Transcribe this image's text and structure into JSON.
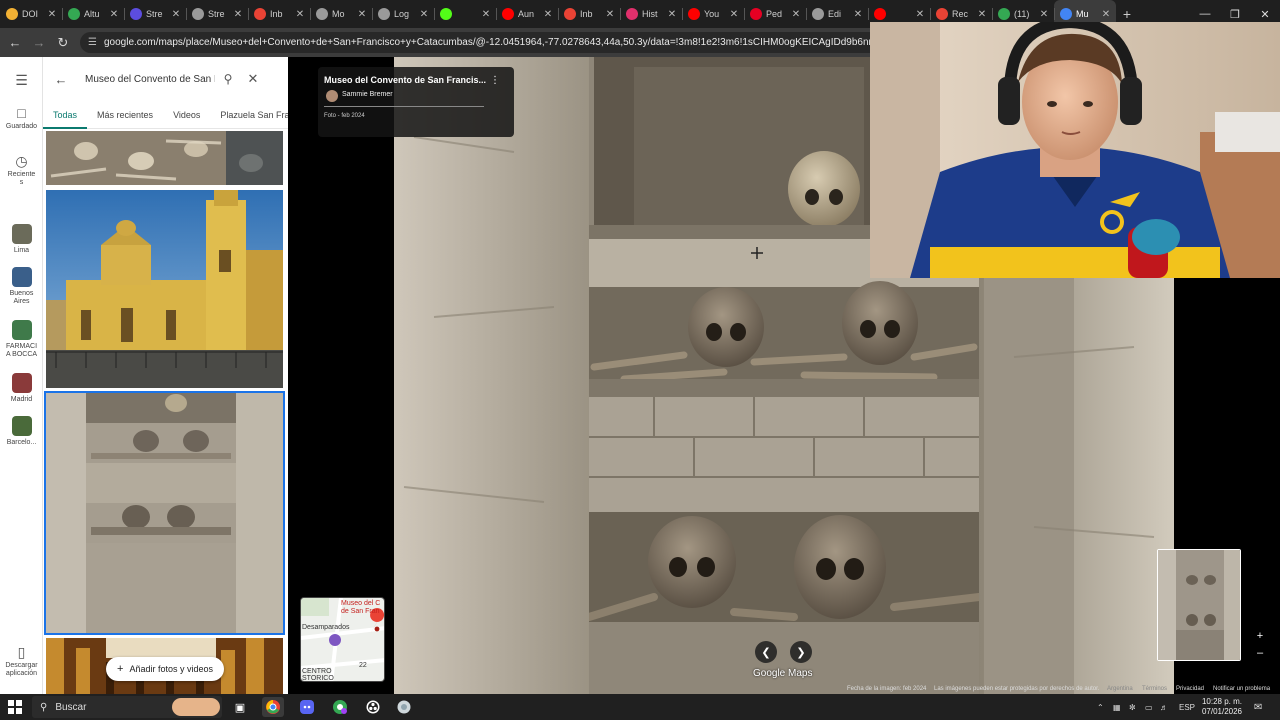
{
  "browser": {
    "tabs": [
      {
        "label": "DOI",
        "icon": "chrome-icon",
        "color": "#f2b134"
      },
      {
        "label": "Altu",
        "icon": "plus-icon",
        "color": "#34a853"
      },
      {
        "label": "Stre",
        "icon": "stream-icon",
        "color": "#5c4ddf"
      },
      {
        "label": "Stre",
        "icon": "globe-icon",
        "color": "#9a9a9a"
      },
      {
        "label": "Inb",
        "icon": "gmail-icon",
        "color": "#ea4335"
      },
      {
        "label": "Mo",
        "icon": "globe-icon",
        "color": "#9a9a9a"
      },
      {
        "label": "Log",
        "icon": "globe-icon",
        "color": "#9a9a9a"
      },
      {
        "label": "",
        "icon": "kick-icon",
        "color": "#53fc18"
      },
      {
        "label": "Aun",
        "icon": "youtube-icon",
        "color": "#ff0000"
      },
      {
        "label": "Inb",
        "icon": "gmail-icon",
        "color": "#ea4335"
      },
      {
        "label": "Hist",
        "icon": "instagram-icon",
        "color": "#e1306c"
      },
      {
        "label": "You",
        "icon": "youtube-icon",
        "color": "#ff0000"
      },
      {
        "label": "Ped",
        "icon": "pinterest-icon",
        "color": "#e60023"
      },
      {
        "label": "Edi",
        "icon": "globe-icon",
        "color": "#9a9a9a"
      },
      {
        "label": "",
        "icon": "youtube-icon",
        "color": "#ff0000"
      },
      {
        "label": "Rec",
        "icon": "gmail-icon",
        "color": "#ea4335"
      },
      {
        "label": "(11)",
        "icon": "sheets-icon",
        "color": "#34a853"
      },
      {
        "label": "Mu",
        "icon": "maps-pin-icon",
        "color": "#4285f4"
      }
    ],
    "active_tab": 17,
    "url": "google.com/maps/place/Museo+del+Convento+de+San+Francisco+y+Catacumbas/@-12.0451964,-77.0278643,44a,50.3y/data=!3m8!1e2!3m6!1sCIHM0ogKEICAgIDd9b6nnwE!2e10!3e12"
  },
  "rail": [
    {
      "label": "Guardado",
      "icon": "bookmark-icon"
    },
    {
      "label": "Reciente\ns",
      "icon": "history-icon"
    },
    {
      "label": "Lima",
      "icon": "place-thumb",
      "color": "#6b6b5a"
    },
    {
      "label": "Buenos\nAires",
      "icon": "place-thumb",
      "color": "#3a5f8a"
    },
    {
      "label": "FARMACI\nA BOCCA",
      "icon": "place-thumb",
      "color": "#3f7a4a"
    },
    {
      "label": "Madrid",
      "icon": "place-thumb",
      "color": "#8a3a3a"
    },
    {
      "label": "Barcelo...",
      "icon": "place-thumb",
      "color": "#4a6a3a"
    },
    {
      "label": "Descargar\naplicación",
      "icon": "phone-icon"
    }
  ],
  "panel": {
    "search_value": "Museo del Convento de San F",
    "tabs": [
      "Todas",
      "Más recientes",
      "Videos",
      "Plazuela San Fra"
    ],
    "selected_tab": 0,
    "add_button": "Añadir fotos y videos"
  },
  "viewer": {
    "title": "Museo del Convento de San Francis...",
    "author": "Sammie Bremer",
    "date": "Foto - feb 2024",
    "minimap_labels": [
      "Museo del C",
      "de San Fran",
      "Desamparados",
      "CENTRO",
      "STORICO",
      "22"
    ],
    "logo": "Google Maps",
    "footer": [
      "Fecha de la imagen: feb 2024",
      "Las imágenes pueden estar protegidas por derechos de autor.",
      "Argentina",
      "Términos",
      "Privacidad",
      "Notificar un problema"
    ]
  },
  "taskbar": {
    "search_placeholder": "Buscar",
    "lang": "ESP",
    "time": "10:28 p. m.",
    "date": "07/01/2026"
  }
}
